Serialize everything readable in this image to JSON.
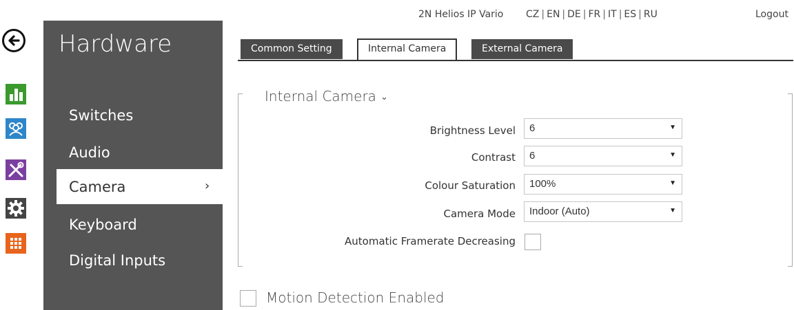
{
  "topbar": {
    "device_name": "2N Helios IP Vario",
    "languages": [
      "CZ",
      "EN",
      "DE",
      "FR",
      "IT",
      "ES",
      "RU"
    ],
    "logout_label": "Logout"
  },
  "rail": {
    "icons": [
      "back-arrow-icon",
      "status-chart-icon",
      "directory-users-icon",
      "hardware-tools-icon",
      "settings-gear-icon",
      "services-grid-icon"
    ],
    "colors": {
      "status": "#3a9a2e",
      "directory": "#2e86c9",
      "hardware": "#7b3fa0",
      "settings": "#444444",
      "services": "#e8641c"
    }
  },
  "sidebar": {
    "title": "Hardware",
    "items": [
      {
        "label": "Switches"
      },
      {
        "label": "Audio"
      },
      {
        "label": "Camera",
        "active": true,
        "chevron": "›"
      },
      {
        "label": "Keyboard"
      },
      {
        "label": "Digital Inputs"
      }
    ]
  },
  "tabs": [
    {
      "label": "Common Setting",
      "active": false
    },
    {
      "label": "Internal Camera",
      "active": true
    },
    {
      "label": "External Camera",
      "active": false
    }
  ],
  "internal_camera": {
    "section_title": "Internal Camera",
    "caret": "⌄",
    "fields": {
      "brightness": {
        "label": "Brightness Level",
        "value": "6"
      },
      "contrast": {
        "label": "Contrast",
        "value": "6"
      },
      "saturation": {
        "label": "Colour Saturation",
        "value": "100%"
      },
      "mode": {
        "label": "Camera Mode",
        "value": "Indoor (Auto)"
      },
      "framerate": {
        "label": "Automatic Framerate Decreasing",
        "checked": false
      }
    }
  },
  "motion_detection": {
    "label": "Motion Detection Enabled",
    "checked": false
  }
}
